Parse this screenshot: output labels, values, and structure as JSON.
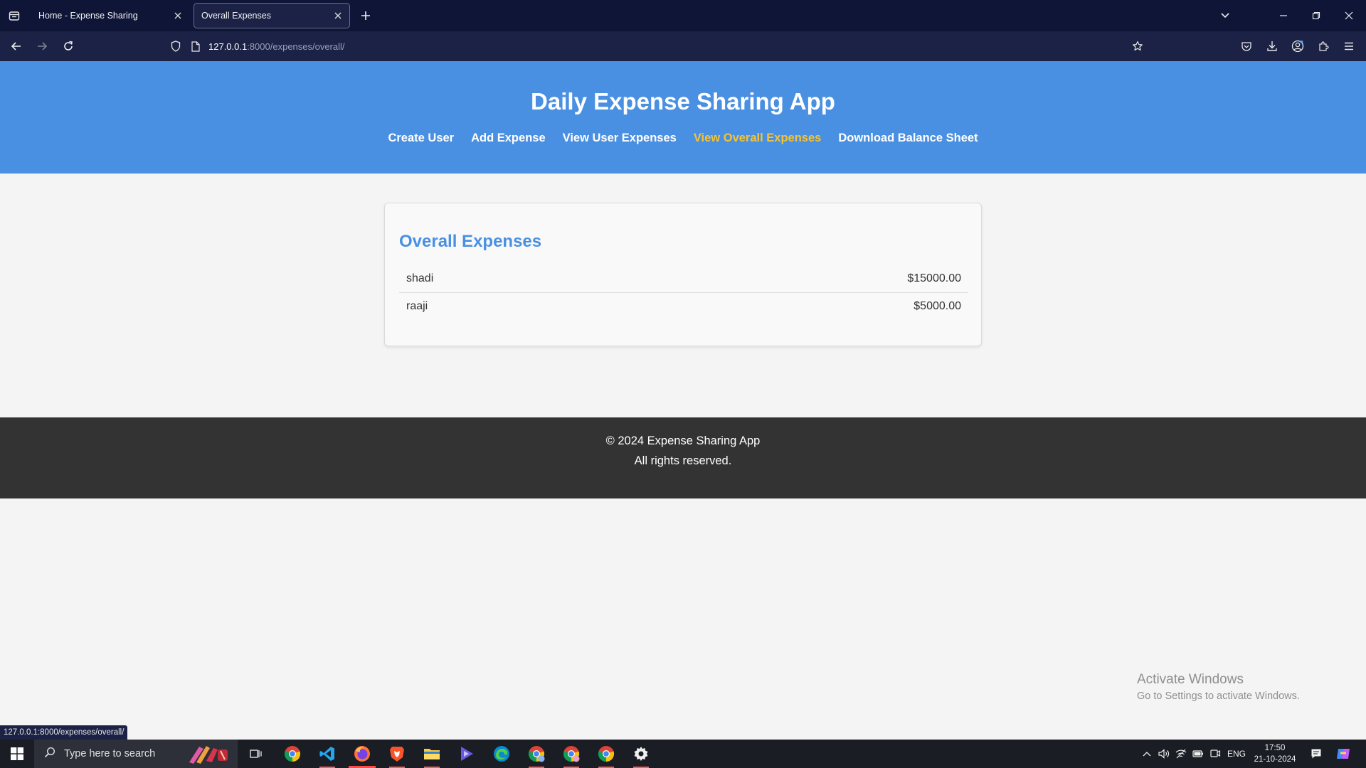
{
  "browser": {
    "tabs": [
      {
        "title": "Home - Expense Sharing",
        "active": false
      },
      {
        "title": "Overall Expenses",
        "active": true
      }
    ],
    "url_host": "127.0.0.1",
    "url_path": ":8000/expenses/overall/",
    "status_link": "127.0.0.1:8000/expenses/overall/"
  },
  "site": {
    "title": "Daily Expense Sharing App",
    "nav": [
      {
        "label": "Create User"
      },
      {
        "label": "Add Expense"
      },
      {
        "label": "View User Expenses"
      },
      {
        "label": "View Overall Expenses",
        "current": true
      },
      {
        "label": "Download Balance Sheet"
      }
    ],
    "nav_current_color": "#f7c331",
    "header_color": "#4a90e2"
  },
  "card": {
    "heading": "Overall Expenses",
    "expenses": [
      {
        "name": "shadi",
        "amount": "$15000.00"
      },
      {
        "name": "raaji",
        "amount": "$5000.00"
      }
    ]
  },
  "footer": {
    "line1": "© 2024 Expense Sharing App",
    "line2": "All rights reserved."
  },
  "watermark": {
    "line1": "Activate Windows",
    "line2": "Go to Settings to activate Windows."
  },
  "taskbar": {
    "search_placeholder": "Type here to search",
    "apps": [
      "task-view",
      "chrome",
      "vscode",
      "firefox",
      "brave",
      "file-explorer",
      "media-player",
      "edge",
      "chrome-profile-2",
      "chrome-profile-3",
      "chrome-profile-4",
      "settings"
    ],
    "language": "ENG",
    "time": "17:50",
    "date": "21-10-2024"
  }
}
